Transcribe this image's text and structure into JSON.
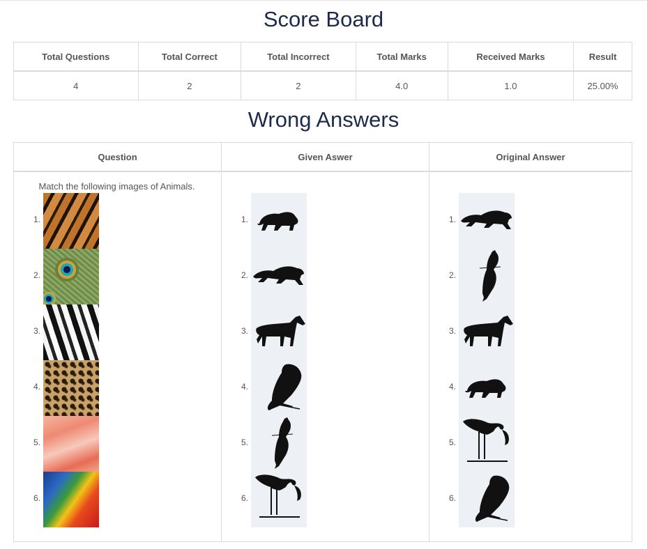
{
  "score_board": {
    "title": "Score Board",
    "headers": [
      "Total Questions",
      "Total Correct",
      "Total Incorrect",
      "Total Marks",
      "Received Marks",
      "Result"
    ],
    "values": [
      "4",
      "2",
      "2",
      "4.0",
      "1.0",
      "25.00%"
    ]
  },
  "wrong_answers": {
    "title": "Wrong Answers",
    "headers": [
      "Question",
      "Given Aswer",
      "Original Answer"
    ],
    "question_text": "Match the following images of Animals.",
    "numbers": [
      "1.",
      "2.",
      "3.",
      "4.",
      "5.",
      "6."
    ],
    "question_images": [
      "tiger-fur-image",
      "peacock-feather-image",
      "zebra-stripes-image",
      "leopard-spots-image",
      "flamingo-feathers-image",
      "macaw-feathers-image"
    ],
    "given_answer": [
      "jaguar-silhouette",
      "tiger-silhouette",
      "zebra-silhouette",
      "parrot-silhouette",
      "peacock-silhouette",
      "flamingo-silhouette"
    ],
    "original_answer": [
      "tiger-silhouette",
      "peacock-silhouette",
      "zebra-silhouette",
      "jaguar-silhouette",
      "flamingo-silhouette",
      "parrot-silhouette"
    ]
  }
}
